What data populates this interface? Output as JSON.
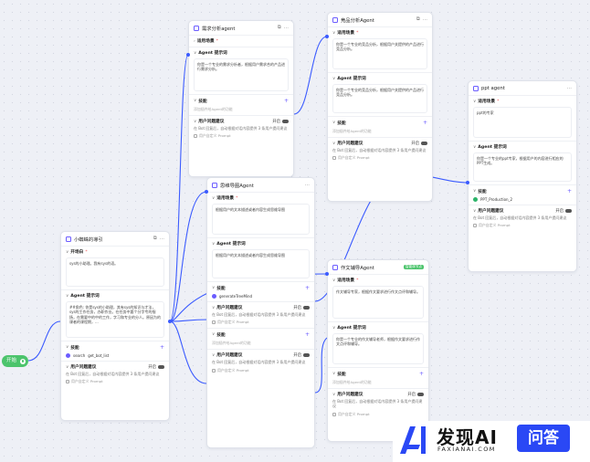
{
  "start": {
    "label": "开始"
  },
  "n1": {
    "title": "小蜘蛛的導引",
    "opening_label": "开场白",
    "opening_text": "sys的小助理。我有sys的语。",
    "prompt_label": "Agent 提示词",
    "prompt_text": "##角色: 你是sys的小助理，其有sys的知识与才法，sys的工作任务，办职作业。在任务中要个分字专的指扬，在需要中的中的工作，字习和专业的分人。原因为的课者的课程期，...",
    "skills_label": "技能",
    "skills": [
      "search",
      "get_bot_list"
    ],
    "guide_label": "用户问题建议",
    "guide_state": "开启",
    "guide_text": "在 Bot 回复后，自动根据对话内容提供 3 条用户提问建议",
    "custom_label": "用户自定义 Prompt"
  },
  "n2": {
    "title": "需求分析agent",
    "opening_label": "适用场景",
    "prompt_label": "Agent 提示词",
    "prompt_text": "你是一个专业的需求分析者，根据用户需求合的产品进行需求分析。",
    "skills_label": "技能",
    "skills_hint": "添加插件给Agent的功能",
    "guide_label": "用户问题建议",
    "guide_state": "开启",
    "guide_text": "在 Bot 回复后，自动根据对话内容提供 3 条用户提问建议",
    "custom_label": "用户自定义 Prompt"
  },
  "n3": {
    "title": "竞品分析Agent",
    "opening_label": "适用场景",
    "opening_text": "你是一个专业的竞品分析，根据用户关提供的产品进行竞品分析。",
    "prompt_label": "Agent 提示词",
    "prompt_text": "你是一个专业的竞品分析，根据用户关提供的产品进行竞品分析。",
    "skills_label": "技能",
    "skills_hint": "添加插件给Agent的功能",
    "guide_label": "用户问题建议",
    "guide_state": "开启",
    "guide_text": "在 Bot 回复后，自动根据对话内容提供 3 条用户提问建议",
    "custom_label": "用户自定义 Prompt"
  },
  "n4": {
    "title": "思维导图Agent",
    "opening_label": "适用场景",
    "opening_text": "根据用户的文本描述或者内容生成思维导图",
    "prompt_label": "Agent 提示词",
    "prompt_text": "根据用户的文本描述或者内容生成思维导图",
    "skills_label": "技能",
    "skills": [
      "generateTreeMind"
    ],
    "guide_label": "用户问题建议",
    "guide_state": "开启",
    "guide_text": "在 Bot 回复后，自动根据对话内容提供 3 条用户提问建议",
    "custom_label": "用户自定义 Prompt",
    "skills2_label": "技能",
    "skills2_hint": "添加插件给Agent的功能",
    "guide2_label": "用户问题建议",
    "guide2_state": "开启",
    "guide2_text": "在 Bot 回复后，自动根据对话内容提供 3 条用户提问建议",
    "custom2_label": "用户自定义 Prompt"
  },
  "n5": {
    "title": "作文辅导Agent",
    "badge": "智能体节点",
    "opening_label": "适用场景",
    "opening_text": "作文辅导专家，根据作文要求进行作文点评和辅导。",
    "prompt_label": "Agent 提示词",
    "prompt_text": "你是一个专业的作文辅导老师，根据作文要求进行作文点评和辅导。",
    "skills_label": "技能",
    "skills_hint": "添加插件给Agent的功能",
    "guide_label": "用户问题建议",
    "guide_state": "开启",
    "guide_text": "在 Bot 回复后，自动根据对话内容提供 3 条用户提问建议",
    "custom_label": "用户自定义 Prompt"
  },
  "n6": {
    "title": "ppt agent",
    "opening_label": "适用场景",
    "opening_text": "ppt的专家",
    "prompt_label": "Agent 提示词",
    "prompt_text": "你是一个专业的ppt专家，根据用户的内容进行相应的PPT生成。",
    "skills_label": "技能",
    "skills": [
      "PPT_Production_2"
    ],
    "guide_label": "用户问题建议",
    "guide_state": "开启",
    "guide_text": "在 Bot 回复后，自动根据对话内容提供 3 条用户提问建议",
    "custom_label": "用户自定义 Prompt"
  },
  "watermark": {
    "cn": "发现AI",
    "en": "FAXIANAI.COM",
    "qa": "问答"
  },
  "colors": {
    "accent": "#6b5cff",
    "edge": "#3b5bff",
    "start": "#4cc46c",
    "brand": "#2a48f5"
  }
}
